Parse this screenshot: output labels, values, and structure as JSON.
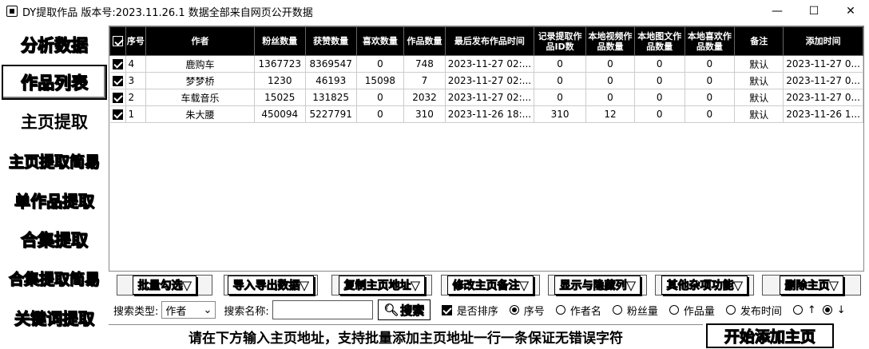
{
  "window": {
    "title": "DY提取作品    版本号:2023.11.26.1  数据全部来自网页公开数据",
    "minimize": "—",
    "maximize": "☐",
    "close": "✕"
  },
  "nav": [
    {
      "label": "分析数据"
    },
    {
      "label": "作品列表"
    },
    {
      "label": "主页提取"
    },
    {
      "label": "主页提取简易"
    },
    {
      "label": "单作品提取"
    },
    {
      "label": "合集提取"
    },
    {
      "label": "合集提取简易"
    },
    {
      "label": "关键词提取"
    }
  ],
  "table": {
    "headers": [
      "序号",
      "作者",
      "粉丝数量",
      "获赞数量",
      "喜欢数量",
      "作品数量",
      "最后发布作品时间",
      "记录提取作品ID数",
      "本地视频作品数量",
      "本地图文作品数量",
      "本地喜欢作品数量",
      "备注",
      "添加时间"
    ],
    "rows": [
      {
        "idx": "4",
        "author": "鹿购车",
        "fans": "1367723",
        "likes": "8369547",
        "fav": "0",
        "works": "748",
        "last": "2023-11-27 02:...",
        "rec": "0",
        "vid": "0",
        "img": "0",
        "lfav": "0",
        "note": "默认",
        "added": "2023-11-27 0..."
      },
      {
        "idx": "3",
        "author": "梦梦桥",
        "fans": "1230",
        "likes": "46193",
        "fav": "15098",
        "works": "7",
        "last": "2023-11-27 02:...",
        "rec": "0",
        "vid": "0",
        "img": "0",
        "lfav": "0",
        "note": "默认",
        "added": "2023-11-27 0..."
      },
      {
        "idx": "2",
        "author": "车载音乐",
        "fans": "15025",
        "likes": "131825",
        "fav": "0",
        "works": "2032",
        "last": "2023-11-27 02:...",
        "rec": "0",
        "vid": "0",
        "img": "0",
        "lfav": "0",
        "note": "默认",
        "added": "2023-11-27 0..."
      },
      {
        "idx": "1",
        "author": "朱大腰",
        "fans": "450094",
        "likes": "5227791",
        "fav": "0",
        "works": "310",
        "last": "2023-11-26 18:...",
        "rec": "310",
        "vid": "12",
        "img": "0",
        "lfav": "0",
        "note": "默认",
        "added": "2023-11-26 1..."
      }
    ]
  },
  "toolbar": {
    "b1": "批量勾选▼",
    "b2": "导入导出数据▼",
    "b3": "复制主页地址▼",
    "b4": "修改主页备注▼",
    "b5": "显示与隐藏列▼",
    "b6": "其他杂项功能▼",
    "b7": "删除主页▼"
  },
  "search": {
    "type_label": "搜索类型:",
    "type_value": "作者",
    "name_label": "搜索名称:",
    "name_value": "",
    "button": "搜索",
    "sort_label": "是否排序",
    "r1": "序号",
    "r2": "作者名",
    "r3": "粉丝量",
    "r4": "作品量",
    "r5": "发布时间",
    "up": "↑",
    "down": "↓"
  },
  "bottom": {
    "hint": "请在下方输入主页地址，支持批量添加主页地址一行一条保证无错误字符",
    "start": "开始添加主页"
  }
}
